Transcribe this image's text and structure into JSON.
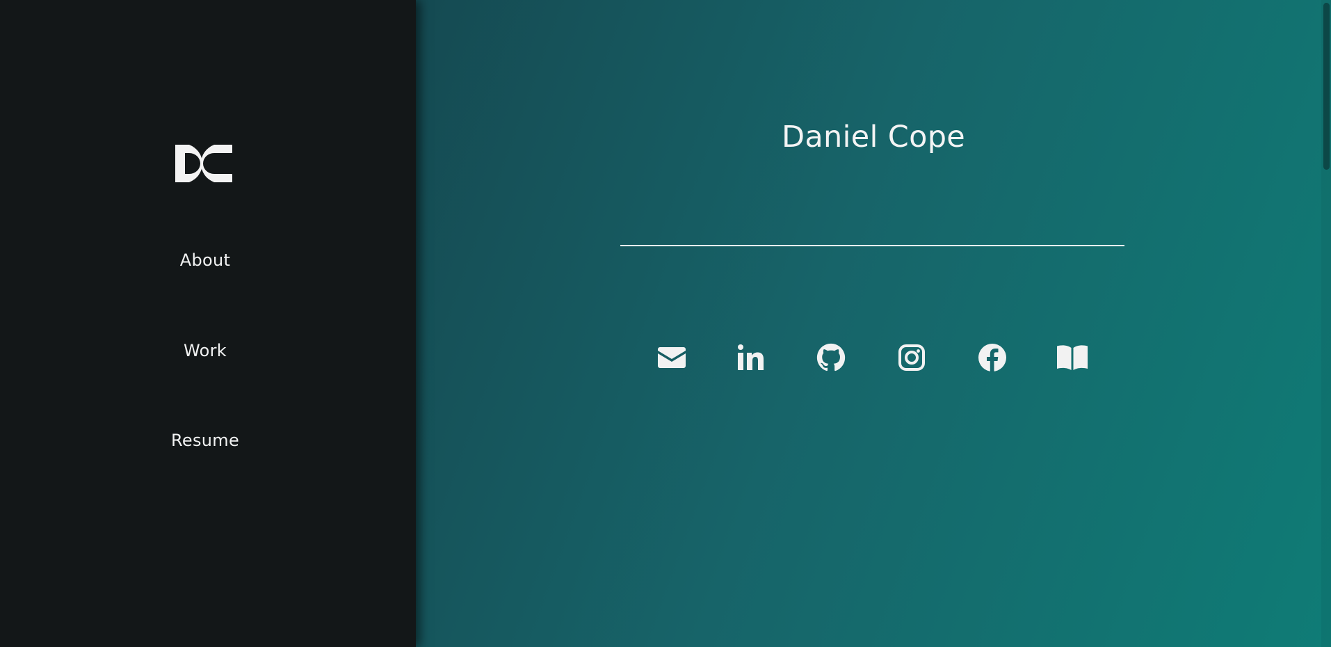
{
  "sidebar": {
    "logo_icon": "dc-monogram-logo",
    "nav": [
      {
        "label": "About"
      },
      {
        "label": "Work"
      },
      {
        "label": "Resume"
      }
    ]
  },
  "main": {
    "title": "Daniel Cope",
    "social_icons": [
      "envelope-icon",
      "linkedin-icon",
      "github-icon",
      "instagram-icon",
      "facebook-icon",
      "book-icon"
    ]
  },
  "colors": {
    "sidebar_bg": "#131718",
    "main_gradient_start": "#154a52",
    "main_gradient_end": "#0f7c76",
    "text": "#f1f2f2"
  }
}
